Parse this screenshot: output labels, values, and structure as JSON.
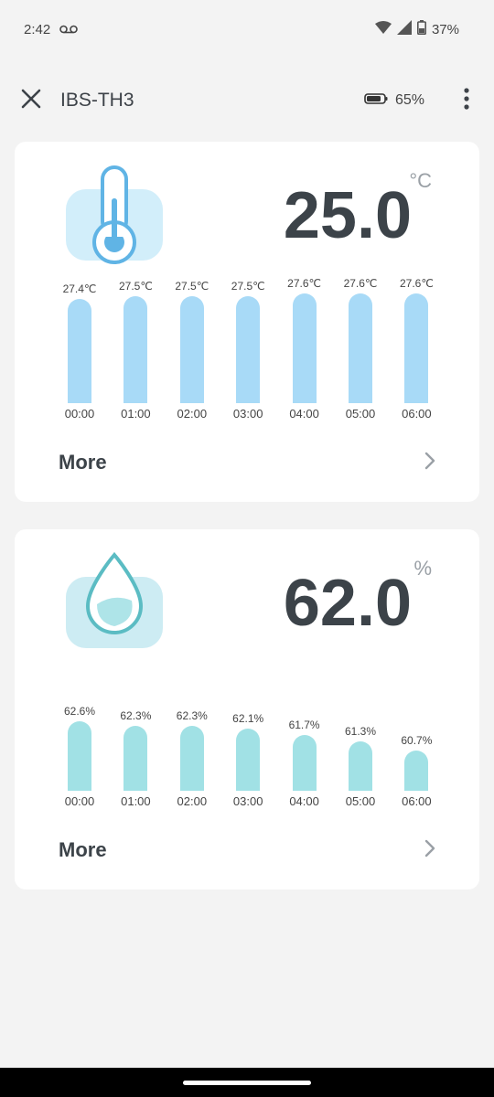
{
  "status": {
    "time": "2:42",
    "battery": "37%"
  },
  "appbar": {
    "title": "IBS-TH3",
    "sensor_battery": "65%"
  },
  "temperature": {
    "value": "25.0",
    "unit": "°C",
    "more_label": "More",
    "chart_data": {
      "type": "bar",
      "categories": [
        "00:00",
        "01:00",
        "02:00",
        "03:00",
        "04:00",
        "05:00",
        "06:00"
      ],
      "values": [
        27.4,
        27.5,
        27.5,
        27.5,
        27.6,
        27.6,
        27.6
      ],
      "labels": [
        "27.4℃",
        "27.5℃",
        "27.5℃",
        "27.5℃",
        "27.6℃",
        "27.6℃",
        "27.6℃"
      ]
    }
  },
  "humidity": {
    "value": "62.0",
    "unit": "%",
    "more_label": "More",
    "chart_data": {
      "type": "bar",
      "categories": [
        "00:00",
        "01:00",
        "02:00",
        "03:00",
        "04:00",
        "05:00",
        "06:00"
      ],
      "values": [
        62.6,
        62.3,
        62.3,
        62.1,
        61.7,
        61.3,
        60.7
      ],
      "labels": [
        "62.6%",
        "62.3%",
        "62.3%",
        "62.1%",
        "61.7%",
        "61.3%",
        "60.7%"
      ]
    }
  },
  "colors": {
    "temp_bar": "#a8daf7",
    "hum_bar": "#a1e1e5",
    "text_dark": "#3c4349"
  }
}
